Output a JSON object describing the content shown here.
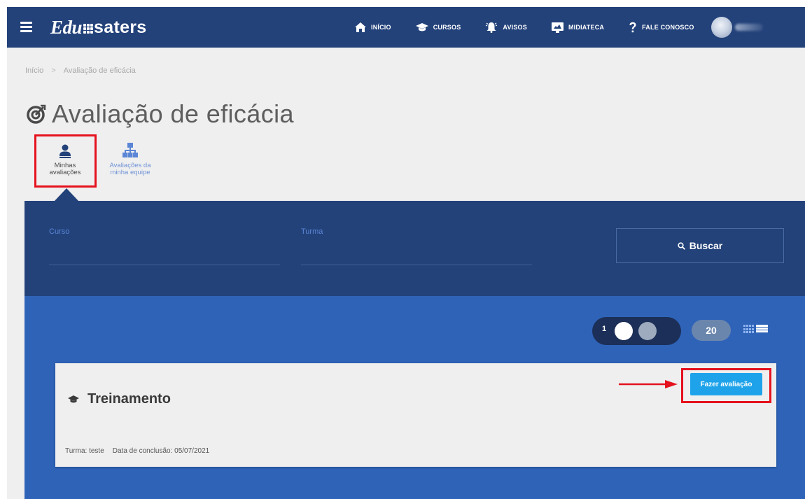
{
  "brand": {
    "script": "Edu",
    "rest": "saters"
  },
  "nav": {
    "items": [
      {
        "label": "INÍCIO",
        "icon": "home-icon"
      },
      {
        "label": "CURSOS",
        "icon": "graduation-cap-icon"
      },
      {
        "label": "AVISOS",
        "icon": "bell-icon"
      },
      {
        "label": "MIDIATECA",
        "icon": "media-icon"
      },
      {
        "label": "FALE CONOSCO",
        "icon": "question-icon"
      }
    ]
  },
  "breadcrumb": {
    "home": "Início",
    "separator": ">",
    "current": "Avaliação de eficácia"
  },
  "page": {
    "title": "Avaliação de eficácia",
    "title_icon": "target-icon"
  },
  "tabs": {
    "mine": {
      "line1": "Minhas",
      "line2": "avaliações",
      "icon": "user-icon"
    },
    "team": {
      "line1": "Avaliações da",
      "line2": "minha equipe",
      "icon": "org-chart-icon"
    }
  },
  "filter": {
    "curso_label": "Curso",
    "turma_label": "Turma",
    "search_label": "Buscar"
  },
  "results": {
    "page_number": "1",
    "per_page": "20"
  },
  "card": {
    "title": "Treinamento",
    "turma": "Turma: teste",
    "conclusao": "Data de conclusão: 05/07/2021",
    "action_label": "Fazer avaliação"
  },
  "colors": {
    "navy": "#23427a",
    "blue": "#2f63b8",
    "action": "#1ea3ea",
    "highlight": "#e5121e"
  }
}
